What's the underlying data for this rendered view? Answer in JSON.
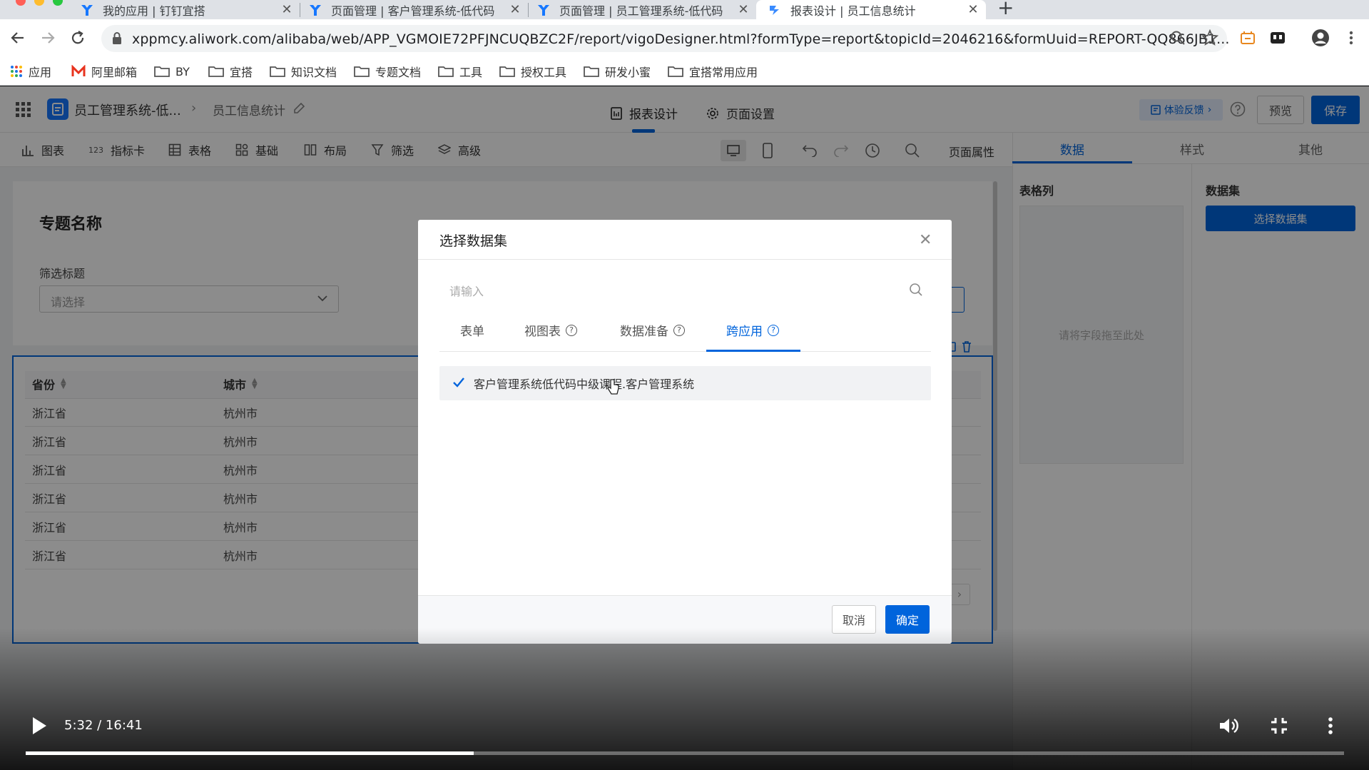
{
  "browser": {
    "tabs": [
      {
        "title": "我的应用 | 钉钉宜搭"
      },
      {
        "title": "页面管理 | 客户管理系统-低代码"
      },
      {
        "title": "页面管理 | 员工管理系统-低代码"
      },
      {
        "title": "报表设计 | 员工信息统计"
      }
    ],
    "url": "xppmcy.aliwork.com/alibaba/web/APP_VGMOIE72PFJNCUQBZC2F/report/vigoDesigner.html?formType=report&topicId=2046216&formUuid=REPORT-QQ866JB1...",
    "bookmarks": [
      "应用",
      "阿里邮箱",
      "BY",
      "宜搭",
      "知识文档",
      "专题文档",
      "工具",
      "授权工具",
      "研发小蜜",
      "宜搭常用应用"
    ]
  },
  "header": {
    "app_name": "员工管理系统-低...",
    "page_name": "员工信息统计",
    "center_tabs": [
      "报表设计",
      "页面设置"
    ],
    "feedback": "体验反馈",
    "preview": "预览",
    "save": "保存"
  },
  "component_toolbar": {
    "items": [
      "图表",
      "指标卡",
      "表格",
      "基础",
      "布局",
      "筛选",
      "高级"
    ],
    "page_props": "页面属性"
  },
  "right_panel": {
    "tabs": [
      "数据",
      "样式",
      "其他"
    ],
    "columns_title": "表格列",
    "drop_hint": "请将字段拖至此处",
    "dataset_title": "数据集",
    "select_dataset": "选择数据集"
  },
  "canvas": {
    "topic_title": "专题名称",
    "filter_label": "筛选标题",
    "filter_placeholder": "请选择",
    "table": {
      "columns": [
        "省份",
        "城市"
      ],
      "rows": [
        [
          "浙江省",
          "杭州市"
        ],
        [
          "浙江省",
          "杭州市"
        ],
        [
          "浙江省",
          "杭州市"
        ],
        [
          "浙江省",
          "杭州市"
        ],
        [
          "浙江省",
          "杭州市"
        ],
        [
          "浙江省",
          "杭州市"
        ]
      ]
    }
  },
  "modal": {
    "title": "选择数据集",
    "search_placeholder": "请输入",
    "tabs": [
      "表单",
      "视图表",
      "数据准备",
      "跨应用"
    ],
    "active_tab": "跨应用",
    "items": [
      "客户管理系统低代码中级课程.客户管理系统"
    ],
    "cancel": "取消",
    "confirm": "确定"
  },
  "video": {
    "time": "5:32 / 16:41",
    "progress": 0.34
  },
  "colors": {
    "primary": "#0064dc",
    "tab_bar": "#dee1e6",
    "canvas_bg": "#f0f2f5"
  }
}
